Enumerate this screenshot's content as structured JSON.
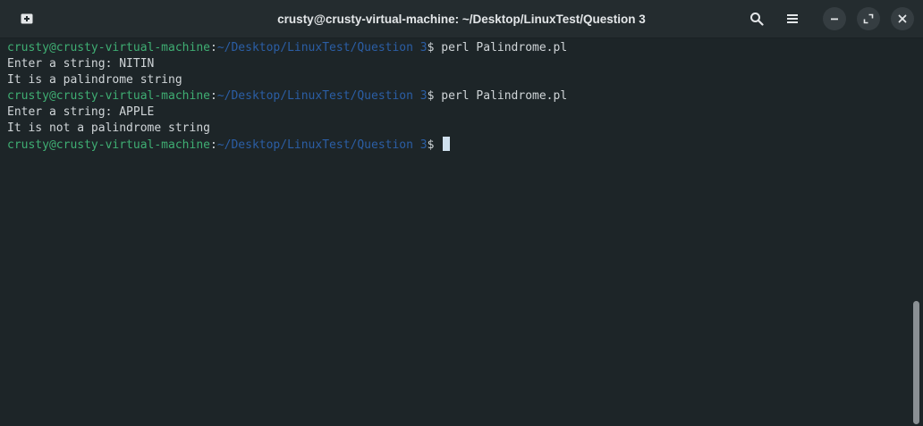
{
  "window": {
    "title": "crusty@crusty-virtual-machine: ~/Desktop/LinuxTest/Question 3"
  },
  "headerbar": {
    "icons": [
      "new-tab-icon",
      "search-icon",
      "hamburger-menu-icon",
      "minimize-icon",
      "maximize-icon",
      "close-icon"
    ]
  },
  "terminal": {
    "lines": [
      {
        "user": "crusty@crusty-virtual-machine",
        "sep": ":",
        "path": "~/Desktop/LinuxTest/Question 3",
        "prompt": "$ ",
        "command": "perl Palindrome.pl"
      },
      {
        "text": "Enter a string: NITIN"
      },
      {
        "text": "It is a palindrome string"
      },
      {
        "user": "crusty@crusty-virtual-machine",
        "sep": ":",
        "path": "~/Desktop/LinuxTest/Question 3",
        "prompt": "$ ",
        "command": "perl Palindrome.pl"
      },
      {
        "text": "Enter a string: APPLE"
      },
      {
        "text": "It is not a palindrome string"
      },
      {
        "user": "crusty@crusty-virtual-machine",
        "sep": ":",
        "path": "~/Desktop/LinuxTest/Question 3",
        "prompt": "$ ",
        "command": ""
      }
    ]
  },
  "colors": {
    "background": "#1d2528",
    "headerbar": "#242c2f",
    "user": "#3fae73",
    "path": "#2b5ea5",
    "text": "#d0d5d8",
    "cursor": "#cfe0ee"
  }
}
